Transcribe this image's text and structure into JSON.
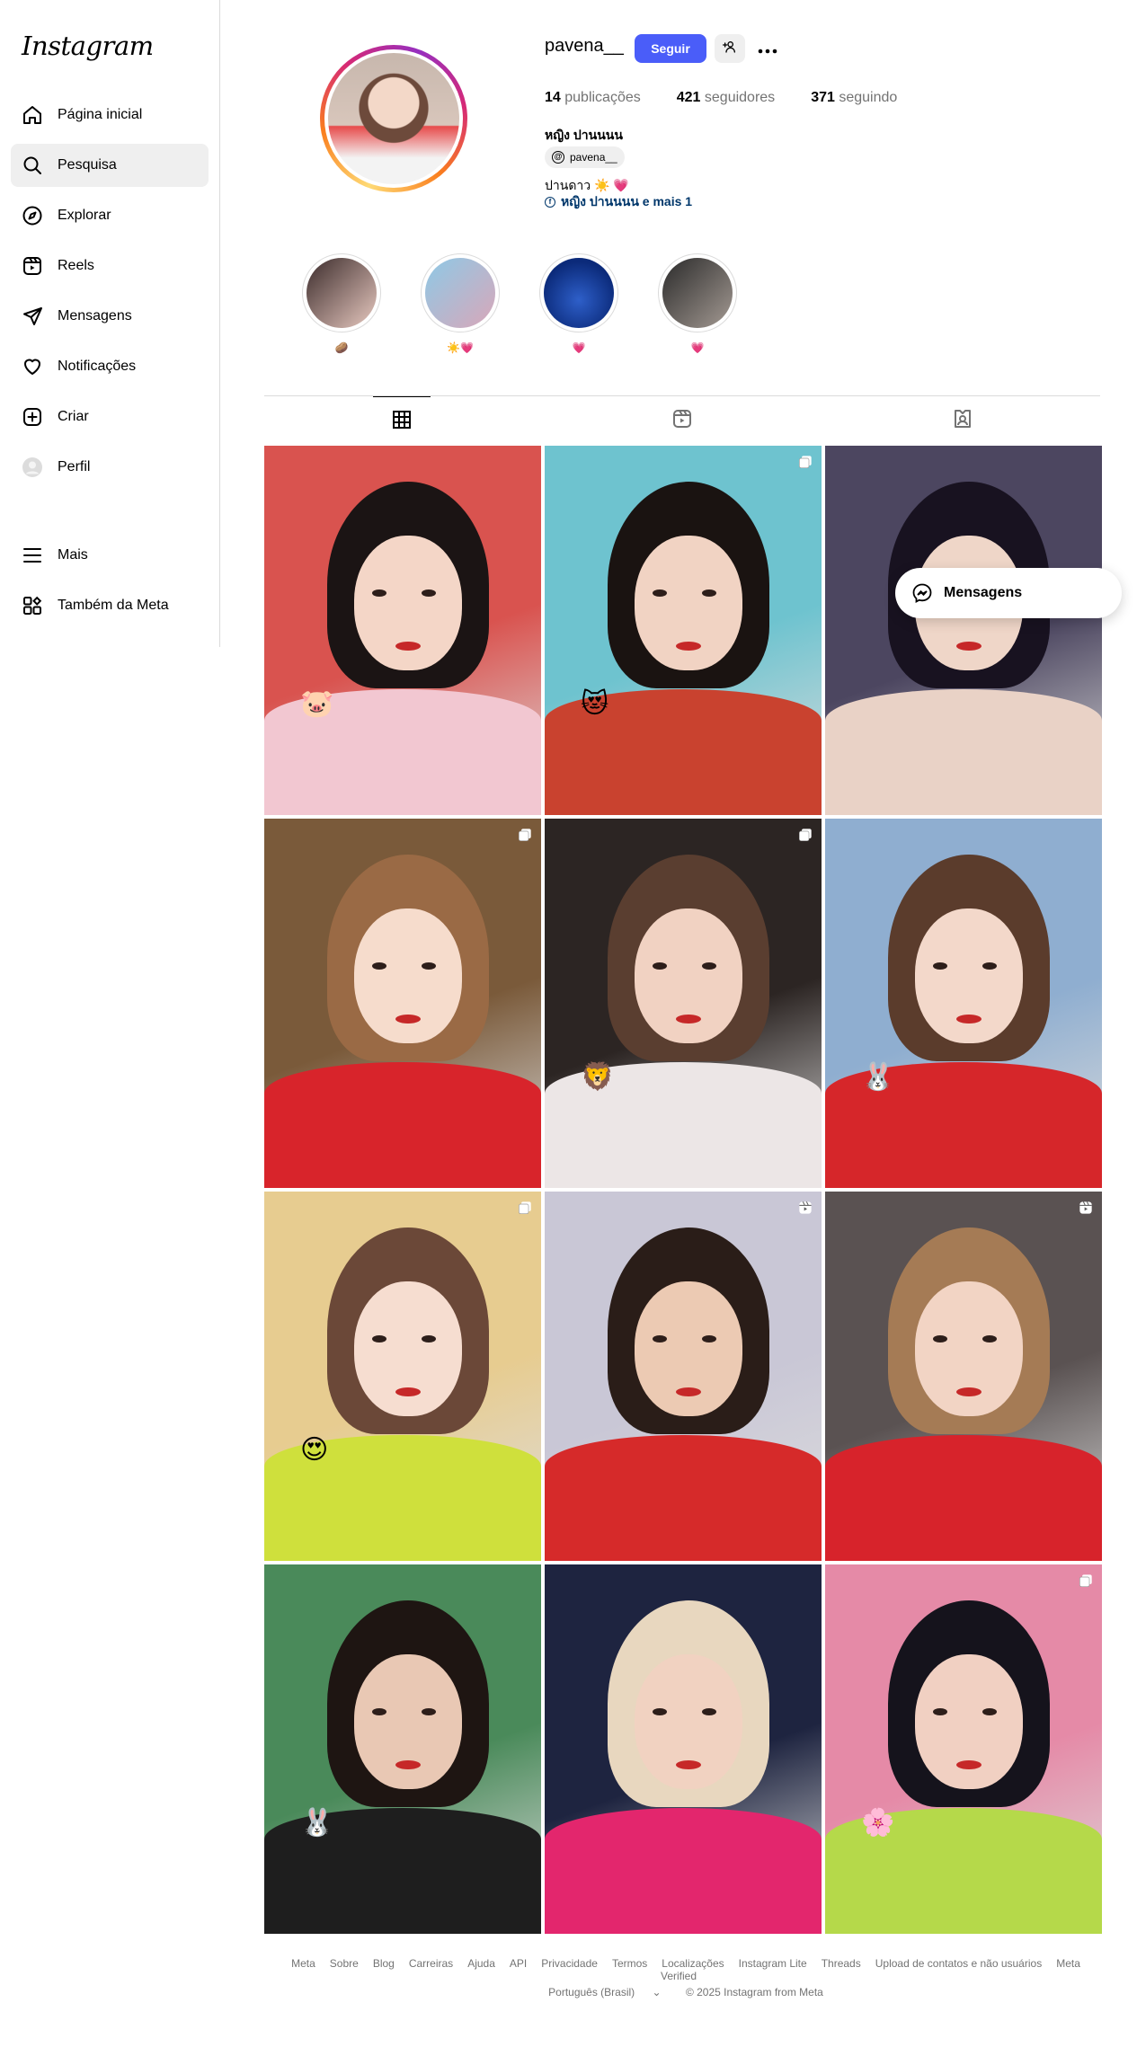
{
  "app": {
    "logo": "Instagram"
  },
  "sidebar": {
    "items": [
      {
        "label": "Página inicial",
        "icon": "home-icon"
      },
      {
        "label": "Pesquisa",
        "icon": "search-icon",
        "active": true
      },
      {
        "label": "Explorar",
        "icon": "compass-icon"
      },
      {
        "label": "Reels",
        "icon": "reels-icon"
      },
      {
        "label": "Mensagens",
        "icon": "send-icon"
      },
      {
        "label": "Notificações",
        "icon": "heart-icon"
      },
      {
        "label": "Criar",
        "icon": "plus-square-icon"
      },
      {
        "label": "Perfil",
        "icon": "avatar-icon"
      }
    ],
    "more_label": "Mais",
    "meta_label": "Também da Meta"
  },
  "profile": {
    "username": "pavena__",
    "follow_label": "Seguir",
    "posts_count": "14",
    "posts_label": "publicações",
    "followers_count": "421",
    "followers_label": "seguidores",
    "following_count": "371",
    "following_label": "seguindo",
    "full_name": "หญิง ปานนนน",
    "threads_handle": "pavena__",
    "bio": "ปานดาว ☀️ 💗",
    "bio_link": "หญิง ปานนนน e mais 1"
  },
  "highlights": [
    {
      "label": "🥔",
      "colors": [
        "#3b2b2b",
        "#e8c9c0"
      ]
    },
    {
      "label": "☀️💗",
      "colors": [
        "#8ec9e6",
        "#d9a7b9"
      ]
    },
    {
      "label": "💗",
      "colors": [
        "#0b2a7a",
        "#2e5fc9"
      ]
    },
    {
      "label": "💗",
      "colors": [
        "#2a2a2a",
        "#a49a93"
      ]
    }
  ],
  "tabs": [
    "posts-tab",
    "reels-tab",
    "tagged-tab"
  ],
  "popup": {
    "label": "Mensagens"
  },
  "posts": [
    {
      "bg": "#d9534f",
      "shirt": "#f2c7d1",
      "hair": "#1b1414",
      "skin": "#f4d6c7",
      "badge": "",
      "sticker": "🐷"
    },
    {
      "bg": "#6ec3cf",
      "shirt": "#c9422f",
      "hair": "#1a1311",
      "skin": "#f1d3c3",
      "badge": "carousel",
      "sticker": "😻"
    },
    {
      "bg": "#4c4660",
      "shirt": "#e9d2c6",
      "hair": "#181220",
      "skin": "#efd6c8",
      "badge": "",
      "sticker": ""
    },
    {
      "bg": "#7a5a3a",
      "shirt": "#d8242b",
      "hair": "#9a6a45",
      "skin": "#f6dccc",
      "badge": "carousel",
      "sticker": ""
    },
    {
      "bg": "#2c2523",
      "shirt": "#ece6e6",
      "hair": "#5a3e30",
      "skin": "#f1d2c2",
      "badge": "carousel",
      "sticker": "🦁"
    },
    {
      "bg": "#8faed0",
      "shirt": "#d6262a",
      "hair": "#5b3c2c",
      "skin": "#f3d8ca",
      "badge": "",
      "sticker": "🐰"
    },
    {
      "bg": "#e7cc90",
      "shirt": "#cfe03c",
      "hair": "#6b4838",
      "skin": "#f6ddd0",
      "badge": "carousel",
      "sticker": "😍"
    },
    {
      "bg": "#c9c7d6",
      "shirt": "#d62a2a",
      "hair": "#2a1d18",
      "skin": "#eccab3",
      "badge": "reel",
      "sticker": ""
    },
    {
      "bg": "#5a5252",
      "shirt": "#d7232b",
      "hair": "#a57b55",
      "skin": "#f2d4c4",
      "badge": "reel",
      "sticker": ""
    },
    {
      "bg": "#4a8a5a",
      "shirt": "#1e1e1e",
      "hair": "#1e1512",
      "skin": "#e9c8b4",
      "badge": "",
      "sticker": "🐰"
    },
    {
      "bg": "#1e2440",
      "shirt": "#e3266d",
      "hair": "#e8d7bf",
      "skin": "#f1d2c1",
      "badge": "",
      "sticker": ""
    },
    {
      "bg": "#e58aa7",
      "shirt": "#b5d94a",
      "hair": "#15131c",
      "skin": "#f1d0c2",
      "badge": "carousel",
      "sticker": "🌸"
    }
  ],
  "footer": {
    "links": [
      "Meta",
      "Sobre",
      "Blog",
      "Carreiras",
      "Ajuda",
      "API",
      "Privacidade",
      "Termos",
      "Localizações",
      "Instagram Lite",
      "Threads",
      "Upload de contatos e não usuários",
      "Meta Verified"
    ],
    "language": "Português (Brasil)",
    "copyright": "© 2025 Instagram from Meta"
  }
}
